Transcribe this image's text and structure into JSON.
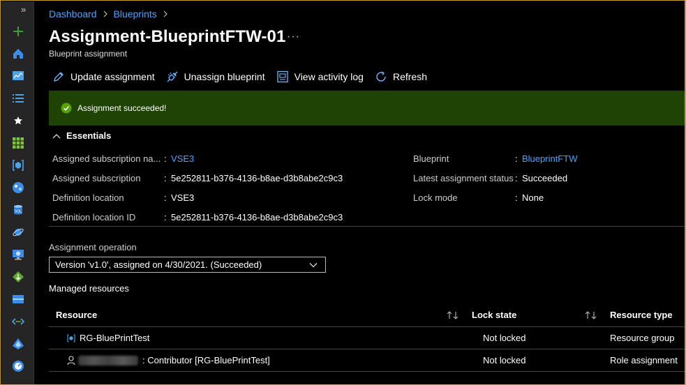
{
  "breadcrumb": {
    "items": [
      "Dashboard",
      "Blueprints"
    ]
  },
  "page": {
    "title": "Assignment-BlueprintFTW-01",
    "subtitle": "Blueprint assignment",
    "more": "···"
  },
  "sidebar": {
    "collapse_glyph": "»",
    "icons": [
      "plus-icon",
      "home-icon",
      "dashboard-icon",
      "all-services-icon",
      "favorites-star-icon",
      "all-resources-icon",
      "resource-groups-icon",
      "app-services-icon",
      "sql-databases-icon",
      "cosmos-db-icon",
      "virtual-machines-icon",
      "load-balancers-icon",
      "storage-accounts-icon",
      "virtual-networks-icon",
      "azure-ad-icon",
      "monitor-icon"
    ]
  },
  "toolbar": {
    "update": "Update assignment",
    "unassign": "Unassign blueprint",
    "activity": "View activity log",
    "refresh": "Refresh"
  },
  "banner": {
    "message": "Assignment succeeded!"
  },
  "essentials": {
    "header": "Essentials",
    "left": [
      {
        "label": "Assigned subscription na...",
        "value": "VSE3"
      },
      {
        "label": "Assigned subscription",
        "value": "5e252811-b376-4136-b8ae-d3b8abe2c9c3"
      },
      {
        "label": "Definition location",
        "value": "VSE3"
      },
      {
        "label": "Definition location ID",
        "value": "5e252811-b376-4136-b8ae-d3b8abe2c9c3"
      }
    ],
    "right": [
      {
        "label": "Blueprint",
        "value": "BlueprintFTW"
      },
      {
        "label": "Latest assignment status",
        "value": "Succeeded"
      },
      {
        "label": "Lock mode",
        "value": "None"
      }
    ],
    "colon": ":"
  },
  "operation": {
    "label": "Assignment operation",
    "selected": "Version 'v1.0', assigned on 4/30/2021. (Succeeded)"
  },
  "managed": {
    "title": "Managed resources",
    "columns": [
      "Resource",
      "Lock state",
      "Resource type"
    ],
    "rows": [
      {
        "resource": "RG-BluePrintTest",
        "lock": "Not locked",
        "type": "Resource group"
      },
      {
        "resource": ": Contributor [RG-BluePrintTest]",
        "lock": "Not locked",
        "type": "Role assignment"
      }
    ]
  },
  "colors": {
    "link": "#4aa3ff",
    "success_banner": "#1e4304",
    "success_check": "#57a300"
  }
}
